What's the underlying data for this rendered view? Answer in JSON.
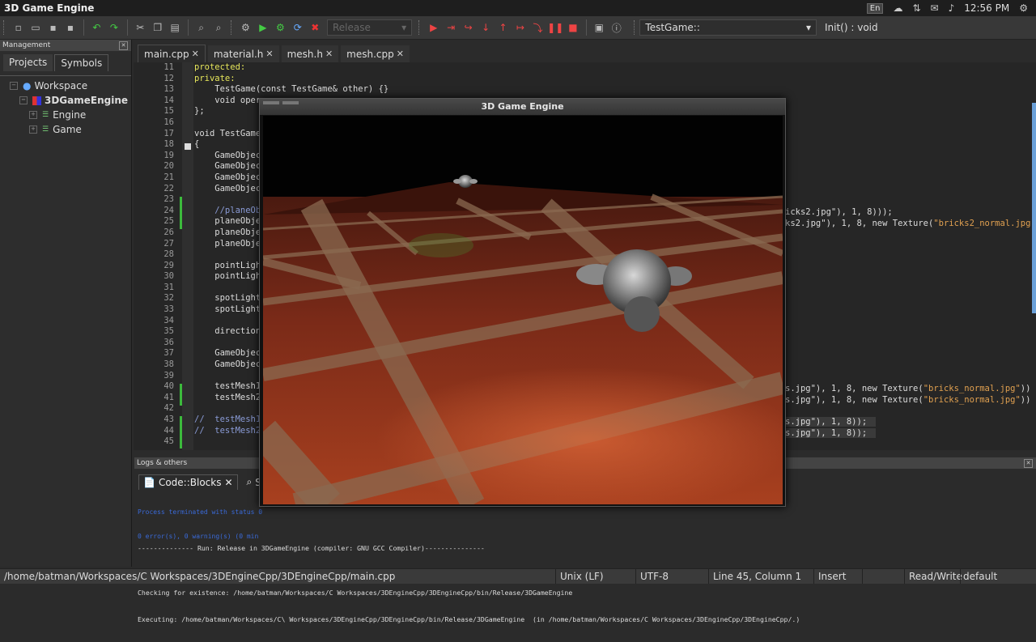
{
  "system_bar": {
    "title": "3D Game Engine",
    "kbd": "En",
    "time": "12:56 PM"
  },
  "toolbar": {
    "build_target": "Release",
    "scope": "TestGame::",
    "function": "Init() : void"
  },
  "management": {
    "header": "Management",
    "tabs": [
      "Projects",
      "Symbols"
    ],
    "tree": [
      {
        "label": "Workspace"
      },
      {
        "label": "3DGameEngine"
      },
      {
        "label": "Engine"
      },
      {
        "label": "Game"
      }
    ]
  },
  "editor_tabs": [
    {
      "label": "main.cpp"
    },
    {
      "label": "material.h"
    },
    {
      "label": "mesh.h"
    },
    {
      "label": "mesh.cpp"
    }
  ],
  "editor": {
    "line_numbers": [
      "11",
      "12",
      "13",
      "14",
      "15",
      "16",
      "17",
      "18",
      "19",
      "20",
      "21",
      "22",
      "23",
      "24",
      "25",
      "26",
      "27",
      "28",
      "29",
      "30",
      "31",
      "32",
      "33",
      "34",
      "35",
      "36",
      "37",
      "38",
      "39",
      "40",
      "41",
      "42",
      "43",
      "44",
      "45"
    ],
    "lines": [
      "protected:",
      "private:",
      "    TestGame(const TestGame& other) {}",
      "    void oper",
      "};",
      "",
      "void TestGame",
      "{",
      "    GameObjec",
      "    GameObjec",
      "    GameObjec",
      "    GameObjec",
      "",
      "    //planeOb",
      "    planeObje",
      "    planeObje",
      "    planeObje",
      "",
      "    pointLigh",
      "    pointLigh",
      "",
      "    spotLight",
      "    spotLight",
      "",
      "    direction",
      "",
      "    GameObjec",
      "    GameObjec",
      "",
      "    testMesh1",
      "    testMesh2",
      "",
      "//  testMesh1",
      "//  testMesh2",
      ""
    ],
    "right_fragments": {
      "l24": "icks2.jpg\"), 1, 8)));",
      "l25a": "ks2.jpg\"), 1, 8, new Texture(",
      "l25b": "\"bricks2_normal.jpg",
      "l40a": "s.jpg\"), 1, 8, new Texture(",
      "l40b": "\"bricks_normal.jpg\"",
      "l40c": "))",
      "l41a": "s.jpg\"), 1, 8, new Texture(",
      "l41b": "\"bricks_normal.jpg\"",
      "l41c": "))",
      "l43": "s.jpg\"), 1, 8));",
      "l44": "s.jpg\"), 1, 8));"
    }
  },
  "logs": {
    "header": "Logs & others",
    "tabs": [
      "Code::Blocks",
      "Sea"
    ],
    "blue_lines": [
      "Process terminated with status 0",
      "0 error(s), 0 warning(s) (0 min"
    ],
    "lines": [
      "-------------- Run: Release in 3DGameEngine (compiler: GNU GCC Compiler)---------------",
      "",
      "Checking for existence: /home/batman/Workspaces/C Workspaces/3DEngineCpp/3DEngineCpp/bin/Release/3DGameEngine",
      "Executing: /home/batman/Workspaces/C\\ Workspaces/3DEngineCpp/3DEngineCpp/bin/Release/3DGameEngine  (in /home/batman/Workspaces/C Workspaces/3DEngineCpp/3DEngineCpp/.)"
    ]
  },
  "status": {
    "path": "/home/batman/Workspaces/C Workspaces/3DEngineCpp/3DEngineCpp/main.cpp",
    "eol": "Unix (LF)",
    "encoding": "UTF-8",
    "position": "Line 45, Column 1",
    "mode": "Insert",
    "access": "Read/Write",
    "profile": "default"
  },
  "game_window": {
    "title": "3D Game Engine"
  },
  "colors": {
    "accent_green": "#3cba3c",
    "keyword": "#e7e75b",
    "string": "#e0a050",
    "comment": "#8a9bd6"
  }
}
